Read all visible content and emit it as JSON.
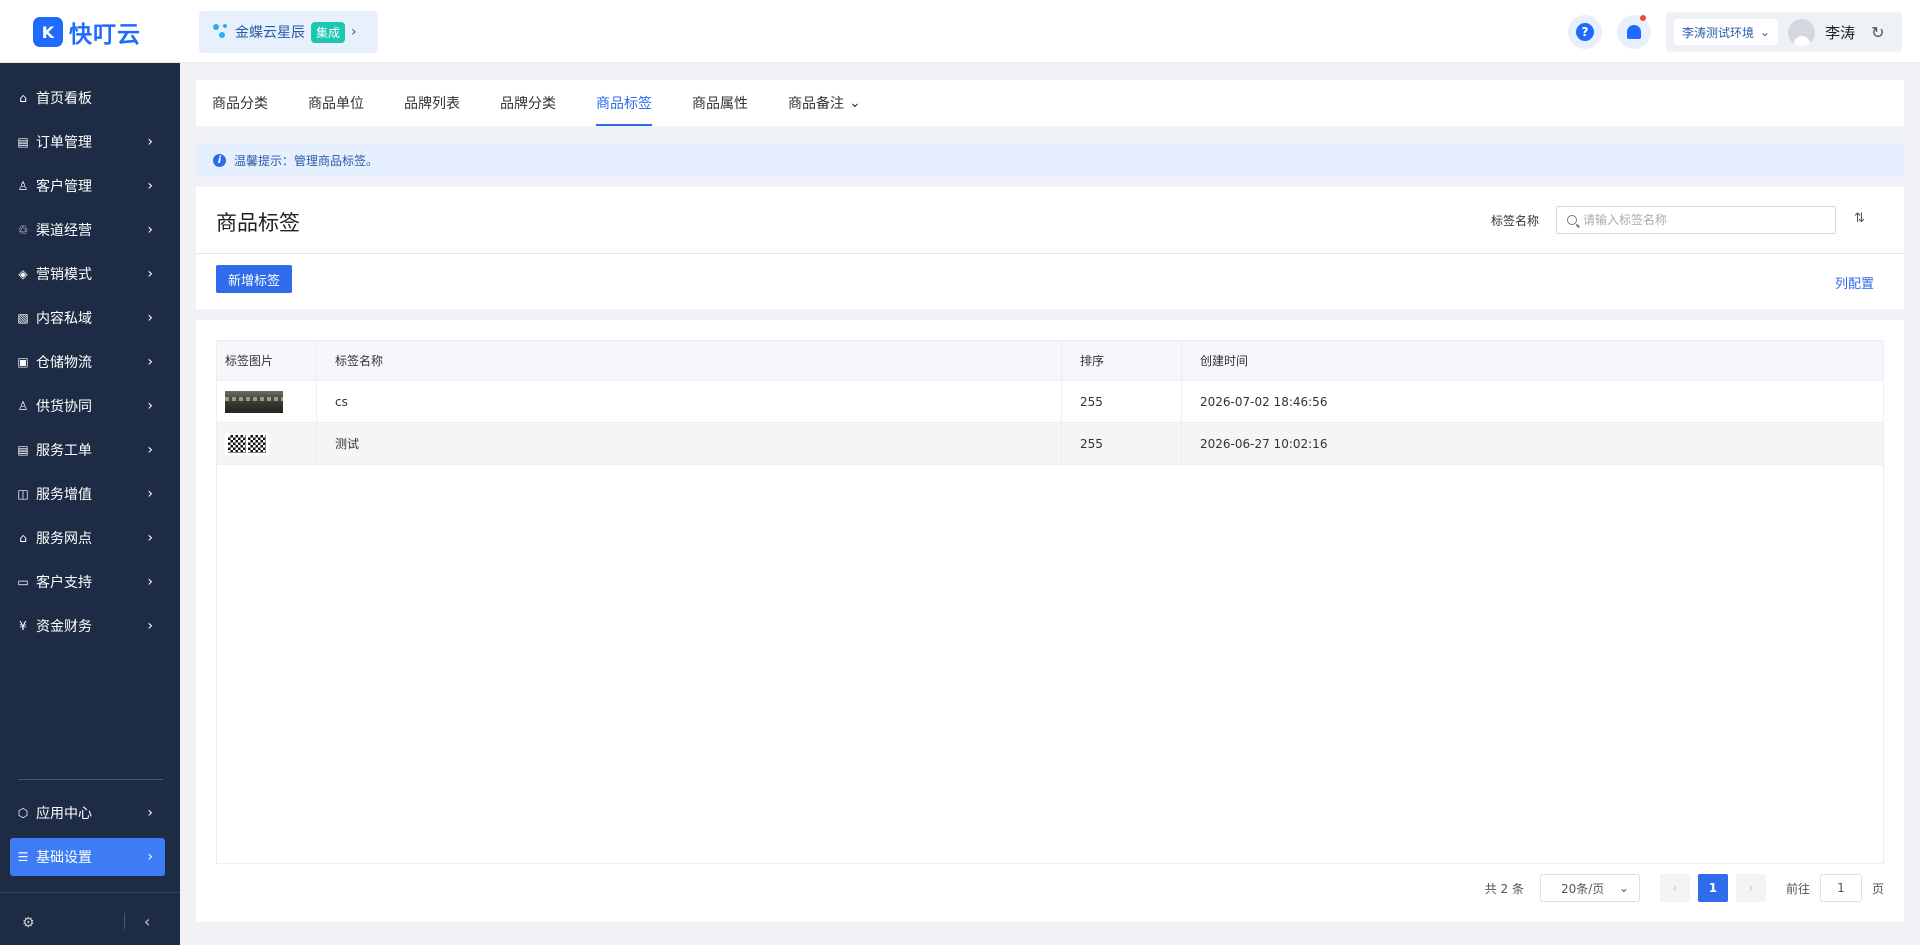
{
  "app": {
    "logo_text": "快叮云"
  },
  "integration": {
    "name": "金蝶云星辰",
    "tag": "集成"
  },
  "header": {
    "env": "李涛测试环境",
    "username": "李涛",
    "help": "?"
  },
  "sidebar": {
    "items": [
      {
        "label": "首页看板"
      },
      {
        "label": "订单管理"
      },
      {
        "label": "客户管理"
      },
      {
        "label": "渠道经营"
      },
      {
        "label": "营销模式"
      },
      {
        "label": "内容私域"
      },
      {
        "label": "仓储物流"
      },
      {
        "label": "供货协同"
      },
      {
        "label": "服务工单"
      },
      {
        "label": "服务增值"
      },
      {
        "label": "服务网点"
      },
      {
        "label": "客户支持"
      },
      {
        "label": "资金财务"
      }
    ],
    "bottom_items": [
      {
        "label": "应用中心"
      },
      {
        "label": "基础设置"
      }
    ]
  },
  "tabs": [
    {
      "label": "商品分类"
    },
    {
      "label": "商品单位"
    },
    {
      "label": "品牌列表"
    },
    {
      "label": "品牌分类"
    },
    {
      "label": "商品标签"
    },
    {
      "label": "商品属性"
    },
    {
      "label": "商品备注"
    }
  ],
  "tip": {
    "text": "温馨提示：管理商品标签。"
  },
  "page": {
    "title": "商品标签",
    "filter_label": "标签名称",
    "search_placeholder": "请输入标签名称",
    "add_button": "新增标签",
    "column_config": "列配置"
  },
  "table": {
    "headers": [
      "标签图片",
      "标签名称",
      "排序",
      "创建时间"
    ],
    "rows": [
      {
        "name": "cs",
        "sort": "255",
        "created": "2026-07-02 18:46:56"
      },
      {
        "name": "测试",
        "sort": "255",
        "created": "2026-06-27 10:02:16"
      }
    ]
  },
  "pagination": {
    "total": "共 2 条",
    "page_size": "20条/页",
    "current": "1",
    "goto_label": "前往",
    "goto_value": "1",
    "page_suffix": "页"
  }
}
